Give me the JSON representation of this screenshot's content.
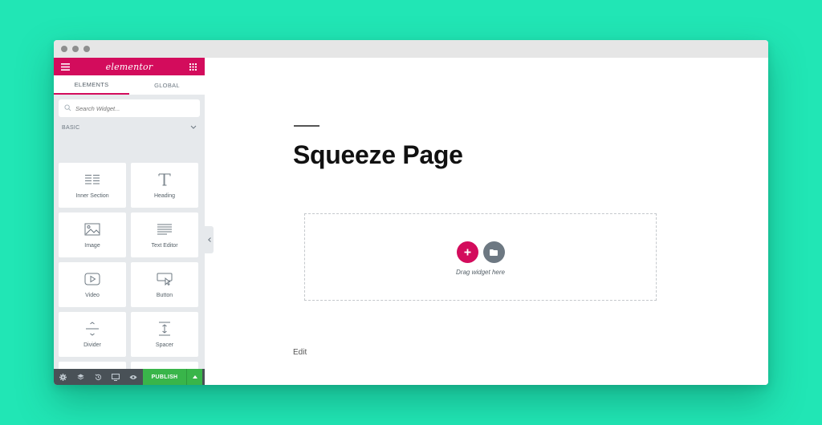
{
  "colors": {
    "background": "#21e6b5",
    "brand": "#d30c5c",
    "publish": "#39b54a",
    "footer": "#495157"
  },
  "sidebar": {
    "logo": "elementor",
    "tabs": [
      {
        "label": "ELEMENTS"
      },
      {
        "label": "GLOBAL"
      }
    ],
    "search": {
      "placeholder": "Search Widget..."
    },
    "section_label": "BASIC",
    "widgets": [
      {
        "label": "Inner Section",
        "icon": "inner-section-icon"
      },
      {
        "label": "Heading",
        "icon": "heading-icon"
      },
      {
        "label": "Image",
        "icon": "image-icon"
      },
      {
        "label": "Text Editor",
        "icon": "text-editor-icon"
      },
      {
        "label": "Video",
        "icon": "video-icon"
      },
      {
        "label": "Button",
        "icon": "button-icon"
      },
      {
        "label": "Divider",
        "icon": "divider-icon"
      },
      {
        "label": "Spacer",
        "icon": "spacer-icon"
      },
      {
        "label": "",
        "icon": "google-maps-icon"
      },
      {
        "label": "",
        "icon": "star-icon"
      }
    ],
    "footer": {
      "publish_label": "PUBLISH"
    }
  },
  "canvas": {
    "title": "Squeeze Page",
    "dropzone_text": "Drag widget here",
    "edit_label": "Edit"
  }
}
